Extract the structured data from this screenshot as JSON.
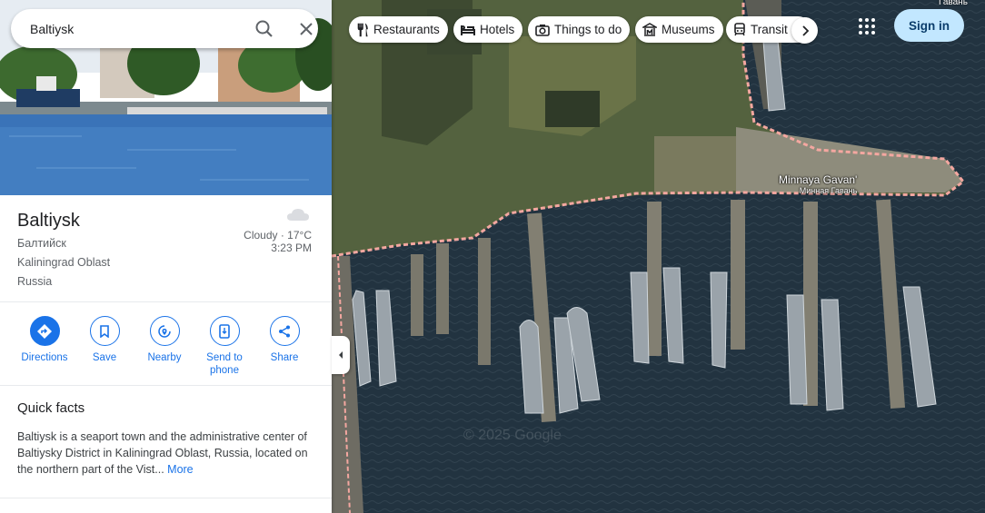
{
  "search": {
    "value": "Baltiysk"
  },
  "place": {
    "name": "Baltiysk",
    "native_name": "Балтийск",
    "region": "Kaliningrad Oblast",
    "country": "Russia",
    "weather_condition": "Cloudy · 17°C",
    "local_time": "3:23 PM"
  },
  "actions": [
    {
      "label": "Directions"
    },
    {
      "label": "Save"
    },
    {
      "label": "Nearby"
    },
    {
      "label": "Send to phone"
    },
    {
      "label": "Share"
    }
  ],
  "quick_facts": {
    "title": "Quick facts",
    "text": "Baltiysk is a seaport town and the administrative center of Baltiysky District in Kaliningrad Oblast, Russia, located on the northern part of the Vist...",
    "more_label": "More"
  },
  "chips": [
    {
      "label": "Restaurants",
      "icon": "restaurant-icon"
    },
    {
      "label": "Hotels",
      "icon": "hotel-icon"
    },
    {
      "label": "Things to do",
      "icon": "camera-icon"
    },
    {
      "label": "Museums",
      "icon": "museum-icon"
    },
    {
      "label": "Transit",
      "icon": "transit-icon"
    }
  ],
  "header": {
    "signin_label": "Sign in",
    "corner_label": "Гавань"
  },
  "map": {
    "poi_name": "Minnaya Gavan'",
    "poi_native_name": "Минная Гавань",
    "watermark": "© 2025 Google"
  },
  "colors": {
    "accent": "#1a73e8",
    "signin_bg": "#c2e7ff",
    "water": "#243540",
    "boundary": "#f4a7a0"
  }
}
